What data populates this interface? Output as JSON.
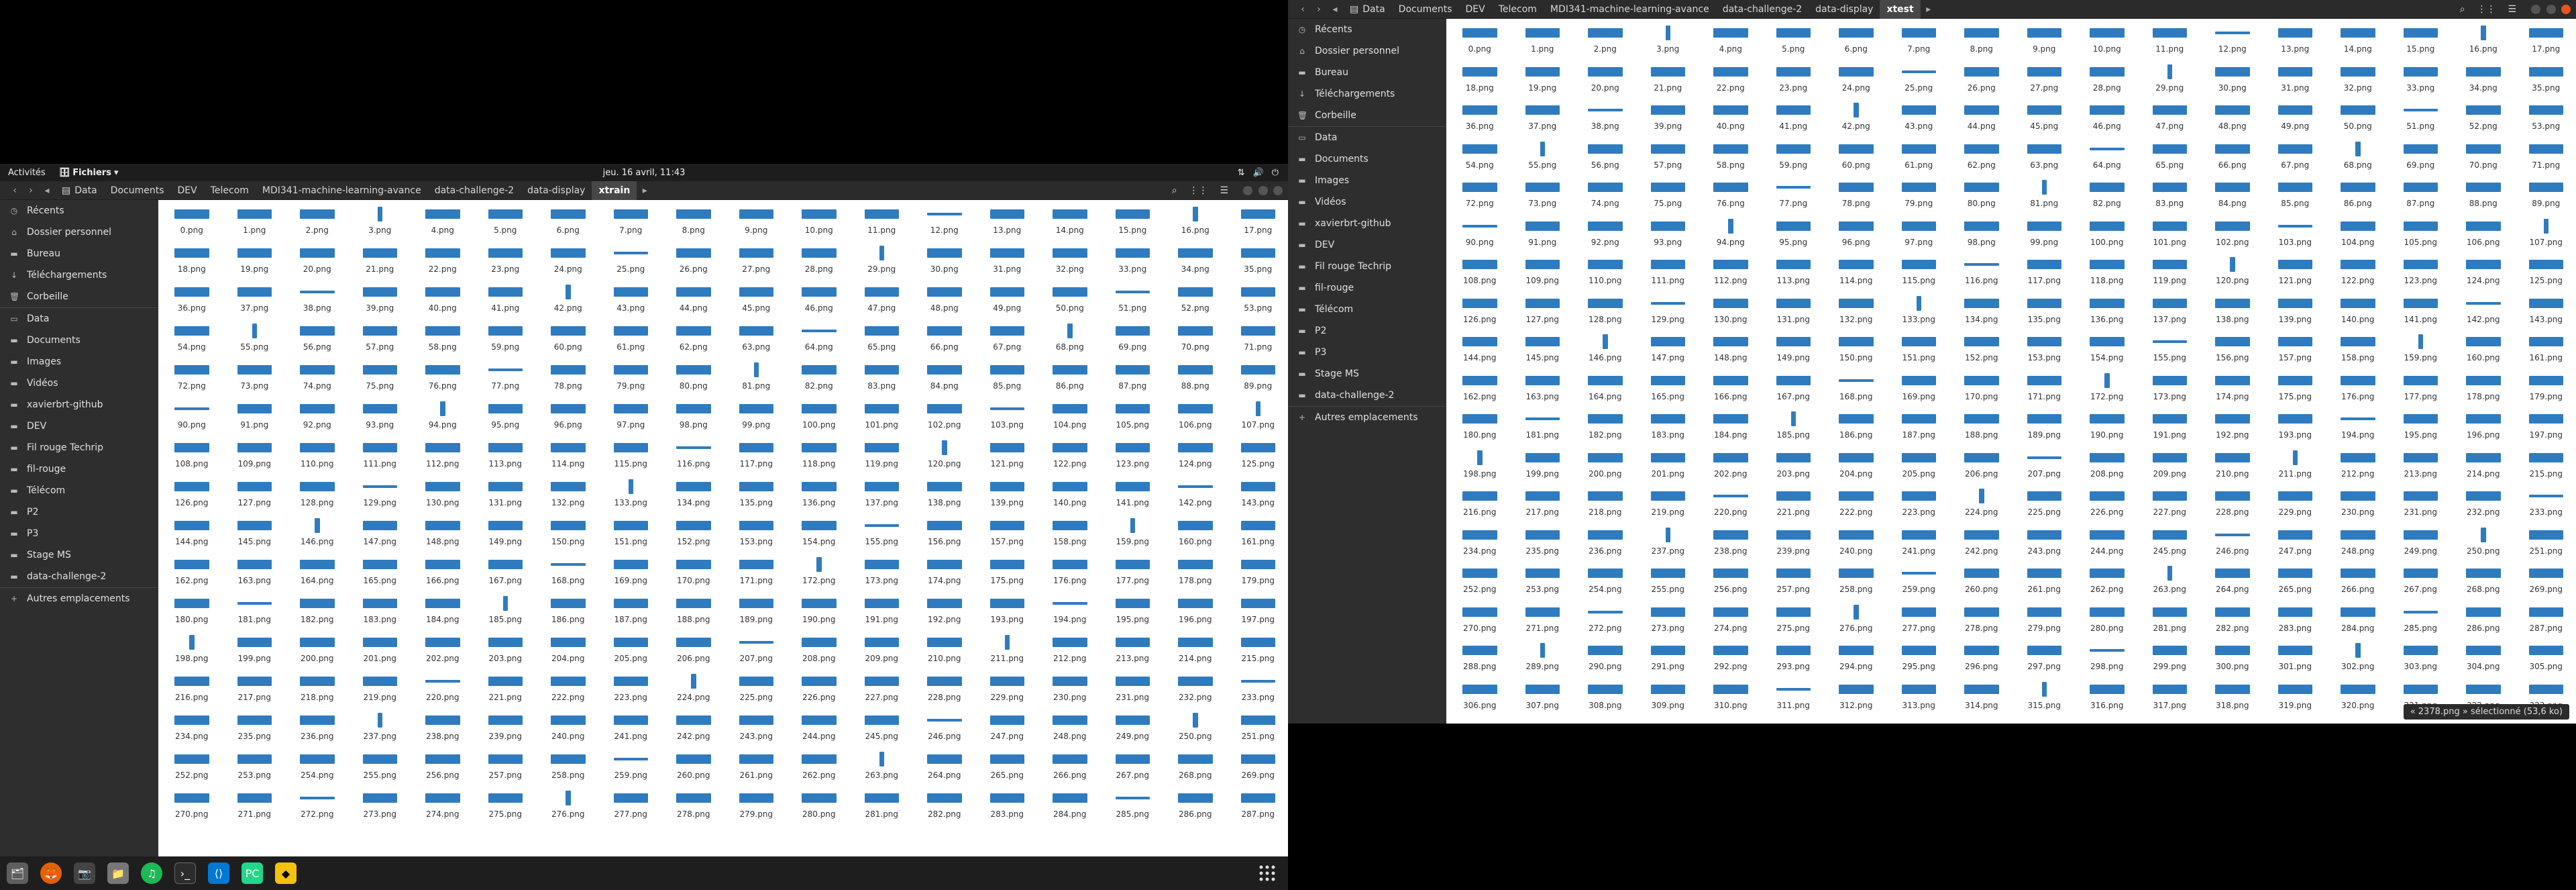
{
  "topbar": {
    "activities": "Activités",
    "app": "Fichiers",
    "clock": "jeu. 16 avril, 11:43"
  },
  "left_window": {
    "crumbs": [
      "Data",
      "Documents",
      "DEV",
      "Telecom",
      "MDI341-machine-learning-avance",
      "data-challenge-2",
      "data-display",
      "xtrain"
    ],
    "sidebar": [
      "Récents",
      "Dossier personnel",
      "Bureau",
      "Téléchargements",
      "Corbeille",
      "Data",
      "Documents",
      "Images",
      "Vidéos",
      "xavierbrt-github",
      "DEV",
      "Fil rouge Techrip",
      "fil-rouge",
      "Télécom",
      "P2",
      "P3",
      "Stage MS",
      "data-challenge-2",
      "Autres emplacements"
    ],
    "file_count": 288
  },
  "right_window": {
    "crumbs": [
      "Data",
      "Documents",
      "DEV",
      "Telecom",
      "MDI341-machine-learning-avance",
      "data-challenge-2",
      "data-display",
      "xtest"
    ],
    "sidebar": [
      "Récents",
      "Dossier personnel",
      "Bureau",
      "Téléchargements",
      "Corbeille",
      "Data",
      "Documents",
      "Images",
      "Vidéos",
      "xavierbrt-github",
      "DEV",
      "Fil rouge Techrip",
      "fil-rouge",
      "Télécom",
      "P2",
      "P3",
      "Stage MS",
      "data-challenge-2",
      "Autres emplacements"
    ],
    "file_count": 324,
    "status": "« 2378.png » sélectionné (53,6 ko)"
  },
  "file_suffix": ".png",
  "colors": {
    "wave": "#2f7bbf",
    "accent": "#e95420"
  },
  "icons": [
    "firefox-icon",
    "camera-icon",
    "files-icon",
    "spotify-icon",
    "terminal-icon",
    "vscode-icon",
    "pycharm-icon",
    "app-icon",
    "app-grid-icon"
  ]
}
